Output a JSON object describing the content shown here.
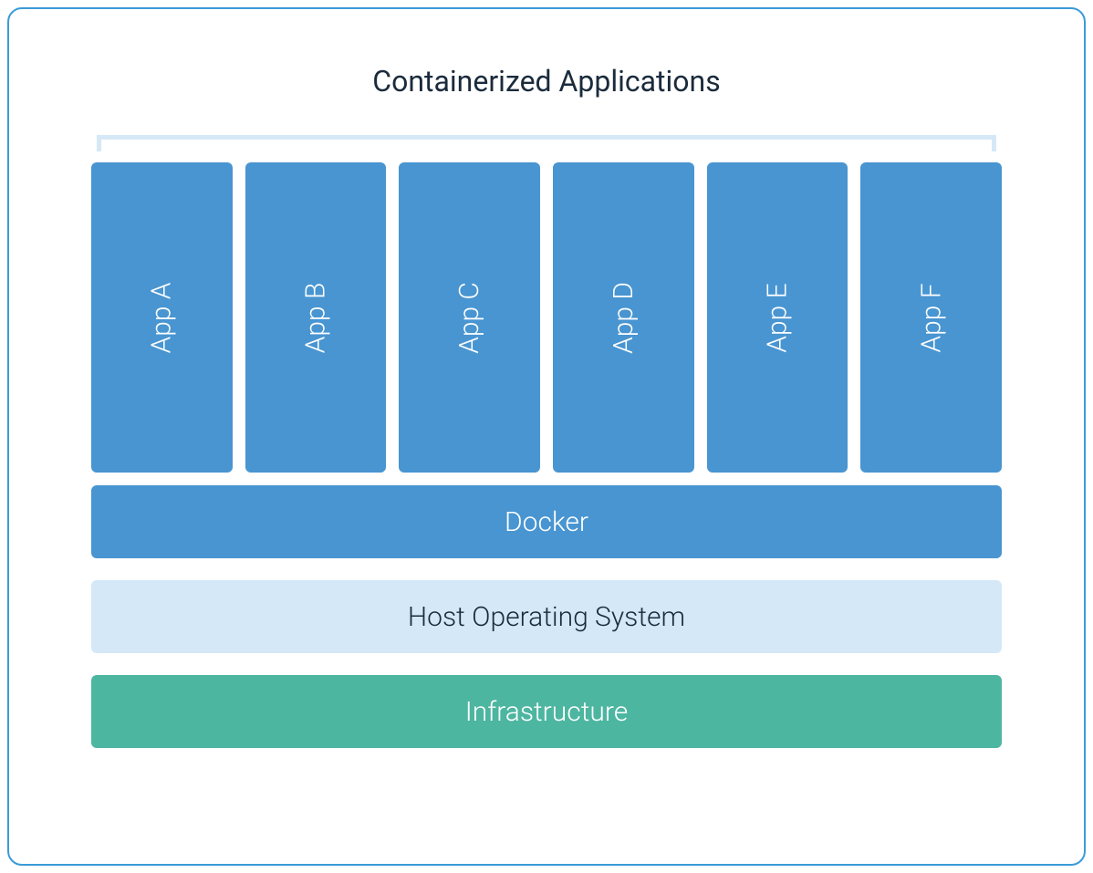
{
  "title": "Containerized Applications",
  "apps": {
    "a": "App A",
    "b": "App B",
    "c": "App C",
    "d": "App D",
    "e": "App E",
    "f": "App F"
  },
  "layers": {
    "docker": "Docker",
    "host_os": "Host Operating System",
    "infrastructure": "Infrastructure"
  },
  "colors": {
    "border": "#3a9bd9",
    "app_box": "#4895d1",
    "docker": "#4895d1",
    "host_os_bg": "#d5e8f7",
    "host_os_text": "#1a2b3c",
    "infrastructure": "#4db6a0",
    "bracket": "#d5e8f7"
  }
}
